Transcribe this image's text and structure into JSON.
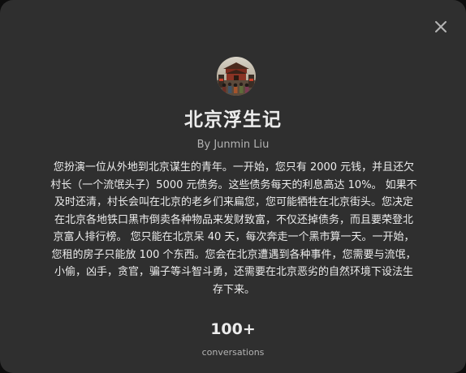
{
  "gpt": {
    "name": "北京浮生记",
    "author": "By Junmin Liu",
    "description": "您扮演一位从外地到北京谋生的青年。一开始，您只有 2000 元钱，并且还欠村长（一个流氓头子）5000 元债务。这些债务每天的利息高达 10%。 如果不及时还清，村长会叫在北京的老乡们来扁您，您可能牺牲在北京街头。您决定在北京各地铁口黑市倒卖各种物品来发财致富，不仅还掉债务，而且要荣登北京富人排行榜。 您只能在北京呆 40 天，每次奔走一个黑市算一天。一开始，您租的房子只能放 100 个东西。您会在北京遭遇到各种事件，您需要与流氓，小偷，凶手，贪官，骗子等斗智斗勇，还需要在北京恶劣的自然环境下设法生存下来。"
  },
  "stats": {
    "conversations_value": "100+",
    "conversations_label": "conversations"
  },
  "icons": {
    "close": "close-icon",
    "avatar": "gpt-avatar"
  },
  "colors": {
    "modal_bg": "#2f2f2f",
    "text_primary": "#ececec",
    "text_secondary": "#b4b4b4"
  }
}
